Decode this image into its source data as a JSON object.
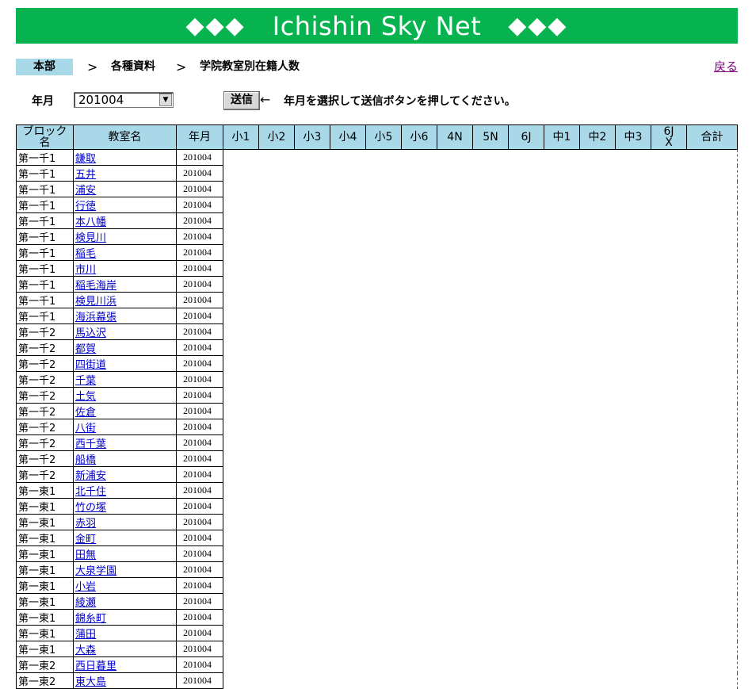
{
  "banner": {
    "title": "Ichishin Sky Net",
    "left_deco": "◆◆◆",
    "right_deco": "◆◆◆"
  },
  "breadcrumb": {
    "home": "本部",
    "sep": ">",
    "level1": "各種資料",
    "level2": "学院教室別在籍人数",
    "back": "戻る"
  },
  "form": {
    "label": "年月",
    "selected": "201004",
    "dropdown_icon": "▼",
    "send": "送信",
    "arrow": "←",
    "hint": "年月を選択して送信ボタンを押してください。"
  },
  "table": {
    "headers": [
      "ブロック名",
      "教室名",
      "年月",
      "小1",
      "小2",
      "小3",
      "小4",
      "小5",
      "小6",
      "4N",
      "5N",
      "6J",
      "中1",
      "中2",
      "中3",
      "6JX",
      "合計"
    ],
    "rows": [
      [
        "第一千1",
        "鎌取",
        "201004"
      ],
      [
        "第一千1",
        "五井",
        "201004"
      ],
      [
        "第一千1",
        "浦安",
        "201004"
      ],
      [
        "第一千1",
        "行徳",
        "201004"
      ],
      [
        "第一千1",
        "本八幡",
        "201004"
      ],
      [
        "第一千1",
        "検見川",
        "201004"
      ],
      [
        "第一千1",
        "稲毛",
        "201004"
      ],
      [
        "第一千1",
        "市川",
        "201004"
      ],
      [
        "第一千1",
        "稲毛海岸",
        "201004"
      ],
      [
        "第一千1",
        "検見川浜",
        "201004"
      ],
      [
        "第一千1",
        "海浜幕張",
        "201004"
      ],
      [
        "第一千2",
        "馬込沢",
        "201004"
      ],
      [
        "第一千2",
        "都賀",
        "201004"
      ],
      [
        "第一千2",
        "四街道",
        "201004"
      ],
      [
        "第一千2",
        "千葉",
        "201004"
      ],
      [
        "第一千2",
        "土気",
        "201004"
      ],
      [
        "第一千2",
        "佐倉",
        "201004"
      ],
      [
        "第一千2",
        "八街",
        "201004"
      ],
      [
        "第一千2",
        "西千葉",
        "201004"
      ],
      [
        "第一千2",
        "船橋",
        "201004"
      ],
      [
        "第一千2",
        "新浦安",
        "201004"
      ],
      [
        "第一東1",
        "北千住",
        "201004"
      ],
      [
        "第一東1",
        "竹の塚",
        "201004"
      ],
      [
        "第一東1",
        "赤羽",
        "201004"
      ],
      [
        "第一東1",
        "金町",
        "201004"
      ],
      [
        "第一東1",
        "田無",
        "201004"
      ],
      [
        "第一東1",
        "大泉学園",
        "201004"
      ],
      [
        "第一東1",
        "小岩",
        "201004"
      ],
      [
        "第一東1",
        "綾瀬",
        "201004"
      ],
      [
        "第一東1",
        "錦糸町",
        "201004"
      ],
      [
        "第一東1",
        "蒲田",
        "201004"
      ],
      [
        "第一東1",
        "大森",
        "201004"
      ],
      [
        "第一東2",
        "西日暮里",
        "201004"
      ],
      [
        "第一東2",
        "東大島",
        "201004"
      ]
    ]
  }
}
